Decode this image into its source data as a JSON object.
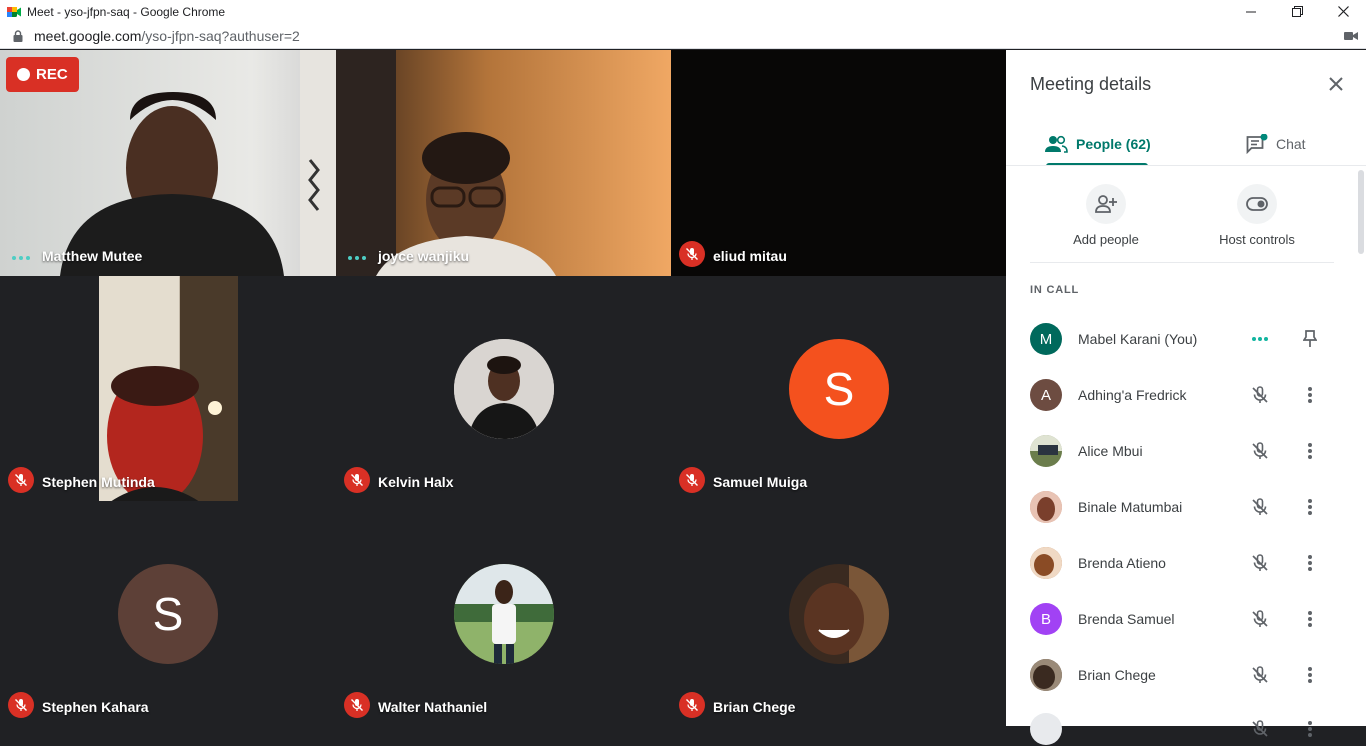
{
  "browser": {
    "window_title": "Meet - yso-jfpn-saq - Google Chrome",
    "url_host": "meet.google.com",
    "url_path": "/yso-jfpn-saq?authuser=2"
  },
  "recording": {
    "label": "REC"
  },
  "tiles": [
    {
      "name": "Matthew Mutee",
      "state": "speaking"
    },
    {
      "name": "joyce wanjiku",
      "state": "speaking"
    },
    {
      "name": "eliud mitau",
      "state": "muted"
    },
    {
      "name": "Stephen Mutinda",
      "state": "muted"
    },
    {
      "name": "Kelvin Halx",
      "state": "muted"
    },
    {
      "name": "Samuel Muiga",
      "state": "muted",
      "initial": "S",
      "color": "#f4511e"
    },
    {
      "name": "Stephen Kahara",
      "state": "muted",
      "initial": "S",
      "color": "#5d4037"
    },
    {
      "name": "Walter Nathaniel",
      "state": "muted"
    },
    {
      "name": "Brian Chege",
      "state": "muted"
    }
  ],
  "panel": {
    "title": "Meeting details",
    "tabs": {
      "people": "People (62)",
      "chat": "Chat"
    },
    "actions": {
      "add_people": "Add people",
      "host_controls": "Host controls"
    },
    "section_label": "IN CALL",
    "participants": [
      {
        "name": "Mabel Karani (You)",
        "initial": "M",
        "color": "#00695c",
        "state": "speaking"
      },
      {
        "name": "Adhing'a Fredrick",
        "initial": "A",
        "color": "#6d4c41",
        "state": "muted"
      },
      {
        "name": "Alice Mbui",
        "initial": "",
        "color": "#8d9b78",
        "state": "muted"
      },
      {
        "name": "Binale Matumbai",
        "initial": "",
        "color": "#c98f7a",
        "state": "muted"
      },
      {
        "name": "Brenda Atieno",
        "initial": "",
        "color": "#b87d52",
        "state": "muted"
      },
      {
        "name": "Brenda Samuel",
        "initial": "B",
        "color": "#a142f4",
        "state": "muted"
      },
      {
        "name": "Brian Chege",
        "initial": "",
        "color": "#5b4a3e",
        "state": "muted"
      }
    ]
  },
  "colors": {
    "accent": "#00796b",
    "mute_red": "#d93025"
  }
}
